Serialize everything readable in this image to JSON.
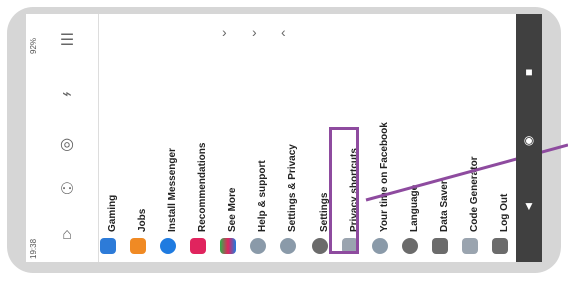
{
  "status": {
    "time": "19:38",
    "battery": "92%"
  },
  "menu_items": [
    {
      "label": "Gaming",
      "icon": "gaming-icon",
      "color": "#2d7bd8"
    },
    {
      "label": "Jobs",
      "icon": "jobs-icon",
      "color": "#f08a24"
    },
    {
      "label": "Install Messenger",
      "icon": "messenger-icon",
      "color": "#1f7be0"
    },
    {
      "label": "Recommendations",
      "icon": "recommendations-icon",
      "color": "#e0245e"
    },
    {
      "label": "See More",
      "icon": "see-more-icon",
      "color": "#6b6b6b"
    },
    {
      "label": "Help & support",
      "icon": "help-icon",
      "color": "#8a9aa9"
    },
    {
      "label": "Settings & Privacy",
      "icon": "settings-privacy-icon",
      "color": "#8a9aa9"
    },
    {
      "label": "Settings",
      "icon": "settings-icon",
      "color": "#6b6b6b"
    },
    {
      "label": "Privacy shortcuts",
      "icon": "lock-icon",
      "color": "#9aa4af"
    },
    {
      "label": "Your time on Facebook",
      "icon": "clock-icon",
      "color": "#8a9aa9"
    },
    {
      "label": "Language",
      "icon": "globe-icon",
      "color": "#6b6b6b"
    },
    {
      "label": "Data Saver",
      "icon": "data-saver-icon",
      "color": "#6b6b6b"
    },
    {
      "label": "Code Generator",
      "icon": "key-icon",
      "color": "#9aa4af"
    },
    {
      "label": "Log Out",
      "icon": "logout-icon",
      "color": "#6b6b6b"
    }
  ],
  "highlight_color": "#8e4b9f"
}
